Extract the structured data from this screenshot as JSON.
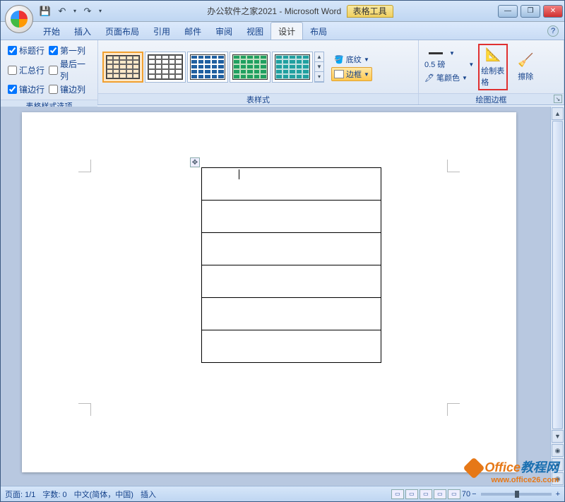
{
  "title": {
    "doc": "办公软件之家2021",
    "app": "Microsoft Word",
    "tool_tab": "表格工具"
  },
  "qat": {
    "save": "💾",
    "undo": "↶",
    "redo": "↷",
    "down": "▾"
  },
  "win": {
    "min": "—",
    "max": "❐",
    "close": "✕"
  },
  "tabs": [
    "开始",
    "插入",
    "页面布局",
    "引用",
    "邮件",
    "审阅",
    "视图",
    "设计",
    "布局"
  ],
  "active_tab": 7,
  "help": "?",
  "ribbon": {
    "style_options": {
      "label": "表格样式选项",
      "items": [
        {
          "label": "标题行",
          "checked": true
        },
        {
          "label": "第一列",
          "checked": true
        },
        {
          "label": "汇总行",
          "checked": false
        },
        {
          "label": "最后一列",
          "checked": false
        },
        {
          "label": "镶边行",
          "checked": true
        },
        {
          "label": "镶边列",
          "checked": false
        }
      ]
    },
    "table_styles": {
      "label": "表样式"
    },
    "shading": {
      "label": "底纹"
    },
    "borders": {
      "label": "边框"
    },
    "pen": {
      "weight": "0.5 磅",
      "color_label": "笔颜色"
    },
    "draw": {
      "label": "绘制表格"
    },
    "erase": {
      "label": "擦除"
    },
    "draw_group": {
      "label": "绘图边框"
    }
  },
  "status": {
    "page": "页面: 1/1",
    "words": "字数: 0",
    "lang": "中文(简体，中国)",
    "mode": "插入",
    "zoom": "70"
  },
  "watermark": {
    "a": "Office",
    "b": "教程网",
    "url": "www.office26.com"
  }
}
